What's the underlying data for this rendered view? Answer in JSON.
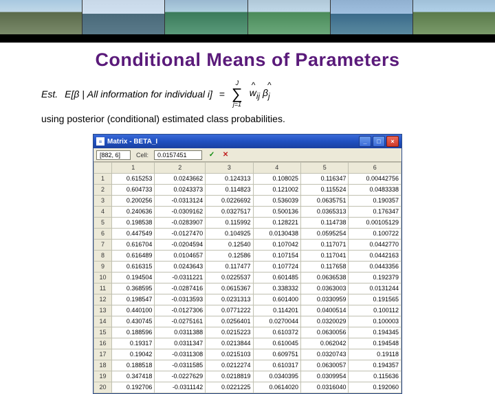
{
  "title": "Conditional Means of Parameters",
  "formula": {
    "lhs_est": "Est.",
    "lhs_exp": "E[β | All information for individual i]",
    "equals": "=",
    "sum_top": "J",
    "sum_bottom": "j=1",
    "w_term": "w",
    "w_sub": "ij",
    "beta_term": "β",
    "beta_sub": "j"
  },
  "formula_desc": "using posterior (conditional) estimated class probabilities.",
  "window": {
    "icon_text": "≡",
    "title": "Matrix - BETA_I",
    "min": "_",
    "max": "□",
    "close": "×"
  },
  "toolbar": {
    "cell_ref": "[882, 6]",
    "cell_label": "Cell:",
    "cell_val": "0.0157451",
    "check": "✓",
    "x": "✕"
  },
  "columns": [
    "",
    "1",
    "2",
    "3",
    "4",
    "5",
    "6"
  ],
  "rows": [
    [
      "1",
      "0.615253",
      "0.0243662",
      "0.124313",
      "0.108025",
      "0.116347",
      "0.00442756"
    ],
    [
      "2",
      "0.604733",
      "0.0243373",
      "0.114823",
      "0.121002",
      "0.115524",
      "0.0483338"
    ],
    [
      "3",
      "0.200256",
      "-0.0313124",
      "0.0226692",
      "0.536039",
      "0.0635751",
      "0.190357"
    ],
    [
      "4",
      "0.240636",
      "-0.0309162",
      "0.0327517",
      "0.500136",
      "0.0365313",
      "0.176347"
    ],
    [
      "5",
      "0.198538",
      "-0.0283907",
      "0.115992",
      "0.128221",
      "0.114738",
      "0.00105129"
    ],
    [
      "6",
      "0.447549",
      "-0.0127470",
      "0.104925",
      "0.0130438",
      "0.0595254",
      "0.100722"
    ],
    [
      "7",
      "0.616704",
      "-0.0204594",
      "0.12540",
      "0.107042",
      "0.117071",
      "0.0442770"
    ],
    [
      "8",
      "0.616489",
      "0.0104657",
      "0.12586",
      "0.107154",
      "0.117041",
      "0.0442163"
    ],
    [
      "9",
      "0.616315",
      "0.0243643",
      "0.117477",
      "0.107724",
      "0.117658",
      "0.0443356"
    ],
    [
      "10",
      "0.194504",
      "-0.0311221",
      "0.0225537",
      "0.601485",
      "0.0636538",
      "0.192379"
    ],
    [
      "11",
      "0.368595",
      "-0.0287416",
      "0.0615367",
      "0.338332",
      "0.0363003",
      "0.0131244"
    ],
    [
      "12",
      "0.198547",
      "-0.0313593",
      "0.0231313",
      "0.601400",
      "0.0330959",
      "0.191565"
    ],
    [
      "13",
      "0.440100",
      "-0.0127306",
      "0.0771222",
      "0.114201",
      "0.0400514",
      "0.100112"
    ],
    [
      "14",
      "0.430745",
      "-0.0275161",
      "0.0256401",
      "0.0270044",
      "0.0320029",
      "0.100003"
    ],
    [
      "15",
      "0.188596",
      "0.0311388",
      "0.0215223",
      "0.610372",
      "0.0630056",
      "0.194345"
    ],
    [
      "16",
      "0.19317",
      "0.0311347",
      "0.0213844",
      "0.610045",
      "0.062042",
      "0.194548"
    ],
    [
      "17",
      "0.19042",
      "-0.0311308",
      "0.0215103",
      "0.609751",
      "0.0320743",
      "0.19118"
    ],
    [
      "18",
      "0.188518",
      "-0.0311585",
      "0.0212274",
      "0.610317",
      "0.0630057",
      "0.194357"
    ],
    [
      "19",
      "0.347418",
      "-0.0227629",
      "0.0218819",
      "0.0340395",
      "0.0309954",
      "0.115636"
    ],
    [
      "20",
      "0.192706",
      "-0.0311142",
      "0.0221225",
      "0.0614020",
      "0.0316040",
      "0.192060"
    ]
  ]
}
